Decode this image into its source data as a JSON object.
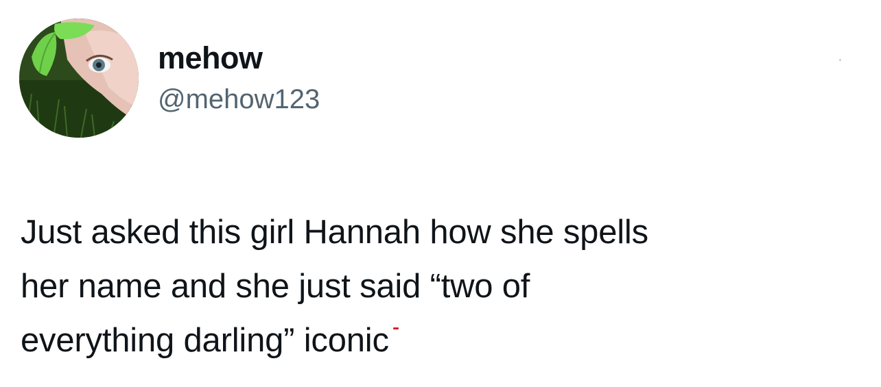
{
  "tweet": {
    "display_name": "mehow",
    "handle": "@mehow123",
    "text": "Just asked this girl Hannah how she spells\nher name and she just said “two of\neverything darling” iconic"
  },
  "avatar": {
    "icon": "profile-photo"
  },
  "colors": {
    "text_primary": "#0f1419",
    "text_secondary": "#536471",
    "background": "#ffffff"
  }
}
